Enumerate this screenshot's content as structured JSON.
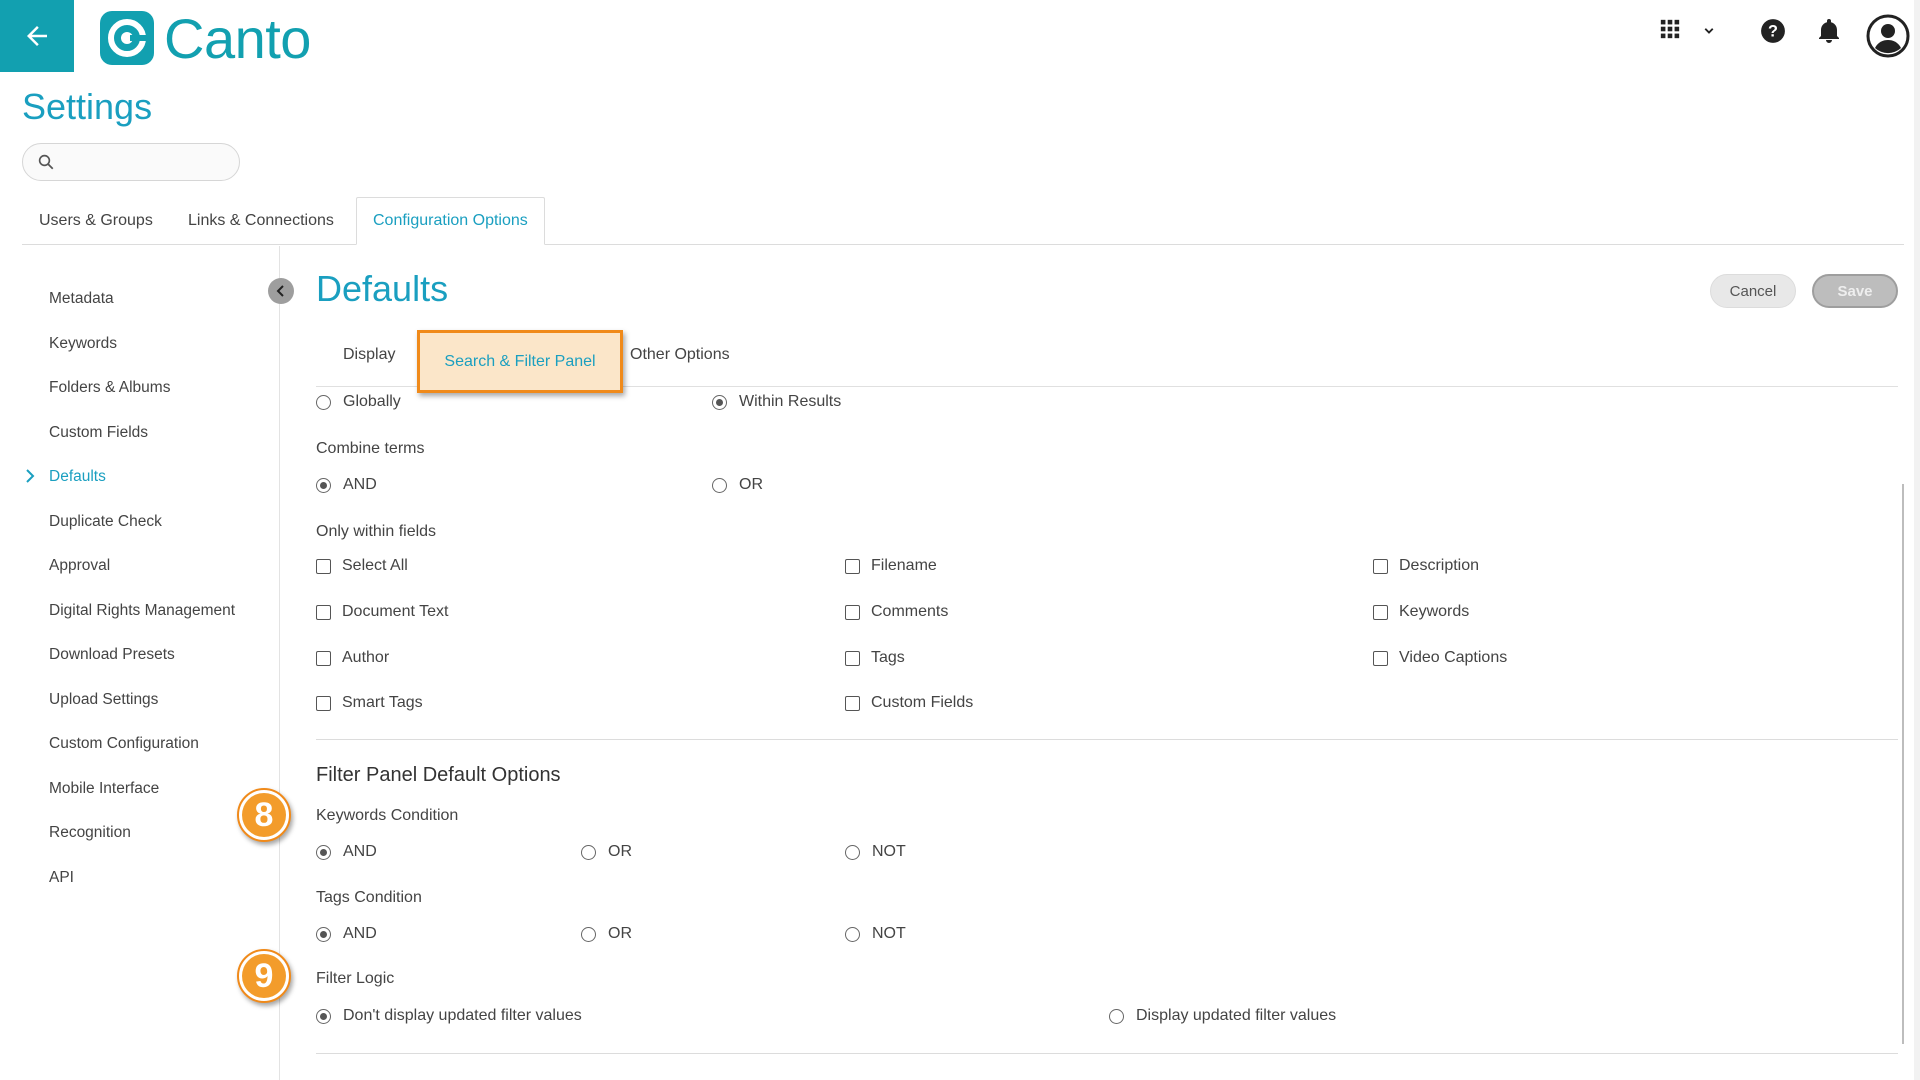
{
  "app": {
    "logo_text": "Canto",
    "brand_color": "#12a0b0",
    "accent_color": "#1a9fc0",
    "highlight_color": "#f08a1a"
  },
  "header": {
    "icons": [
      "back-arrow-icon",
      "apps-grid-icon",
      "chevron-down-icon",
      "help-icon",
      "bell-icon",
      "user-avatar-icon"
    ]
  },
  "page": {
    "title": "Settings",
    "search": {
      "value": "",
      "placeholder": ""
    }
  },
  "top_tabs": [
    {
      "label": "Users & Groups",
      "active": false
    },
    {
      "label": "Links & Connections",
      "active": false
    },
    {
      "label": "Configuration Options",
      "active": true
    }
  ],
  "sidebar": {
    "items": [
      {
        "label": "Metadata"
      },
      {
        "label": "Keywords"
      },
      {
        "label": "Folders & Albums"
      },
      {
        "label": "Custom Fields"
      },
      {
        "label": "Defaults",
        "active": true
      },
      {
        "label": "Duplicate Check"
      },
      {
        "label": "Approval"
      },
      {
        "label": "Digital Rights Management"
      },
      {
        "label": "Download Presets"
      },
      {
        "label": "Upload Settings"
      },
      {
        "label": "Custom Configuration"
      },
      {
        "label": "Mobile Interface"
      },
      {
        "label": "Recognition"
      },
      {
        "label": "API"
      }
    ]
  },
  "main": {
    "title": "Defaults",
    "cancel_label": "Cancel",
    "save_label": "Save",
    "sub_tabs": [
      {
        "label": "Display"
      },
      {
        "label": "Search & Filter Panel",
        "active": true
      },
      {
        "label": "Other Options"
      }
    ],
    "search_scope": {
      "options": [
        {
          "label": "Globally",
          "selected": false
        },
        {
          "label": "Within Results",
          "selected": true
        }
      ]
    },
    "combine_terms": {
      "label": "Combine terms",
      "options": [
        {
          "label": "AND",
          "selected": true
        },
        {
          "label": "OR",
          "selected": false
        }
      ]
    },
    "within_fields": {
      "label": "Only within fields",
      "options": [
        "Select All",
        "Filename",
        "Description",
        "Document Text",
        "Comments",
        "Keywords",
        "Author",
        "Tags",
        "Video Captions",
        "Smart Tags",
        "Custom Fields"
      ]
    },
    "filter_panel": {
      "title": "Filter Panel Default Options",
      "keywords_condition": {
        "label": "Keywords Condition",
        "options": [
          {
            "label": "AND",
            "selected": true
          },
          {
            "label": "OR",
            "selected": false
          },
          {
            "label": "NOT",
            "selected": false
          }
        ]
      },
      "tags_condition": {
        "label": "Tags Condition",
        "options": [
          {
            "label": "AND",
            "selected": true
          },
          {
            "label": "OR",
            "selected": false
          },
          {
            "label": "NOT",
            "selected": false
          }
        ]
      },
      "filter_logic": {
        "label": "Filter Logic",
        "options": [
          {
            "label": "Don't display updated filter values",
            "selected": true
          },
          {
            "label": "Display updated filter values",
            "selected": false
          }
        ]
      }
    },
    "badges": [
      "8",
      "9"
    ]
  }
}
